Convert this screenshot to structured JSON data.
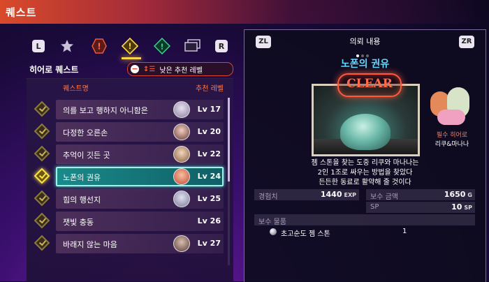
{
  "header": {
    "title": "퀘스트"
  },
  "categories": {
    "left_button": "L",
    "right_button": "R",
    "items": [
      {
        "icon": "star-icon"
      },
      {
        "icon": "red-exclamation-hexagon-icon"
      },
      {
        "icon": "yellow-exclamation-diamond-icon"
      },
      {
        "icon": "green-exclamation-diamond-icon"
      },
      {
        "icon": "cards-icon"
      }
    ]
  },
  "list": {
    "section_title": "히어로 퀘스트",
    "sort_label": "낮은 추천 레벨",
    "col_name": "퀘스트명",
    "col_level": "추천 레벨",
    "rows": [
      {
        "name": "의를 보고 행하지 아니함은",
        "level": "Lv 17"
      },
      {
        "name": "다정한 오른손",
        "level": "Lv 20"
      },
      {
        "name": "추억이 깃든 곳",
        "level": "Lv 22"
      },
      {
        "name": "노폰의 권유",
        "level": "Lv 24",
        "selected": true
      },
      {
        "name": "힘의 행선지",
        "level": "Lv 25"
      },
      {
        "name": "잿빛 충동",
        "level": "Lv 26"
      },
      {
        "name": "바래지 않는 마음",
        "level": "Lv 27"
      }
    ]
  },
  "detail": {
    "left_button": "ZL",
    "right_button": "ZR",
    "header": "의뢰 내용",
    "title": "노폰의 권유",
    "stamp": "CLEAR",
    "hero_label": "필수 히어로",
    "hero_name": "리쿠&마나나",
    "desc": [
      "젬 스톤을 찾는 도중 리쿠와 마나나는",
      "2인 1조로 싸우는 방법을 찾았다",
      "든든한 동료로 활약해 줄 것이다"
    ],
    "exp_label": "경험치",
    "exp_value": "1440",
    "exp_unit": "EXP",
    "gold_label": "보수 금액",
    "gold_value": "1650",
    "gold_unit": "G",
    "sp_label": "SP",
    "sp_value": "10",
    "sp_unit": "SP",
    "reward_header": "보수 물품",
    "reward_item": "초고순도 젬 스톤",
    "reward_qty": "1"
  },
  "colors": {
    "accent_orange": "#ff7a4a",
    "accent_cyan": "#5fd8ff",
    "selected_teal": "#1a8a8a",
    "clear_red": "#ff5a3c"
  }
}
